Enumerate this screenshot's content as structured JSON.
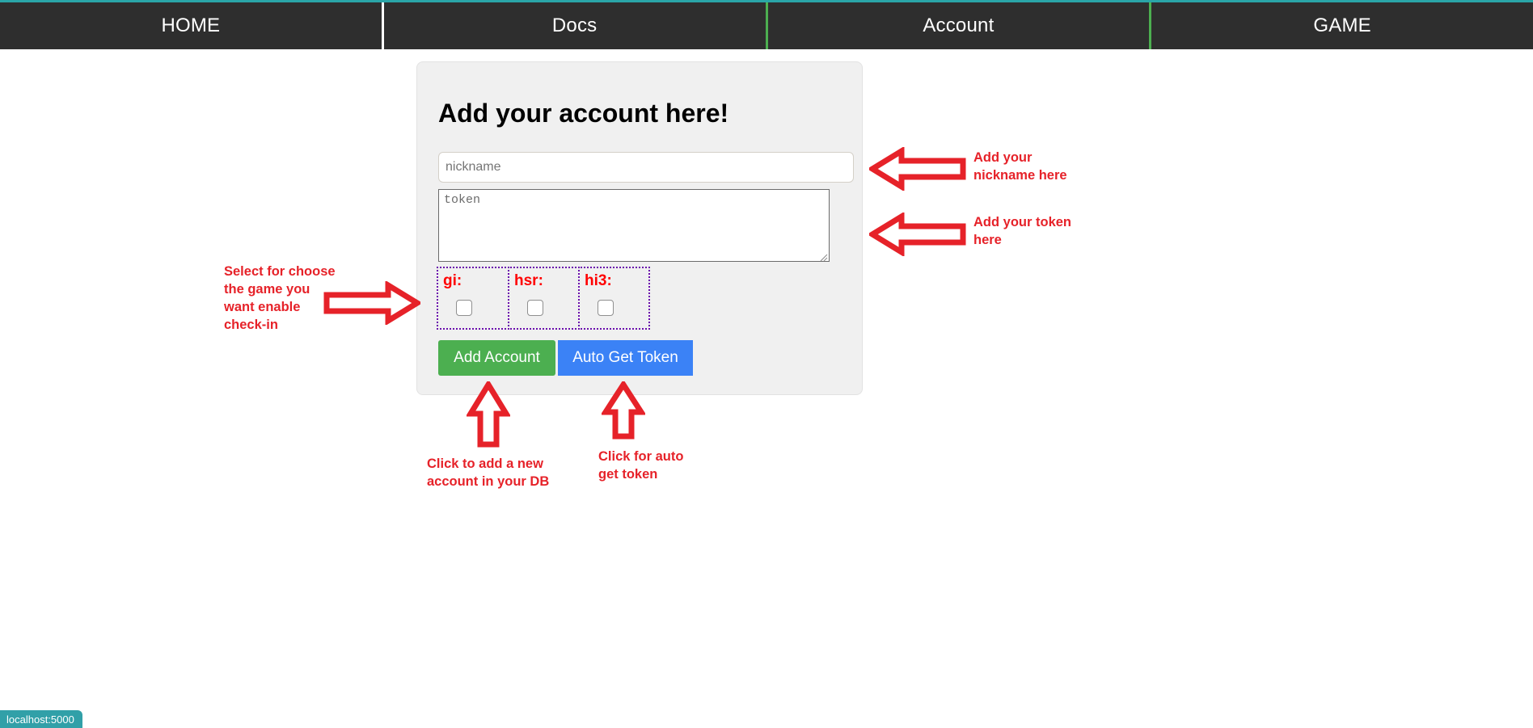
{
  "navbar": {
    "tabs": [
      {
        "label": "HOME",
        "separator": "white",
        "active": true
      },
      {
        "label": "Docs",
        "separator": "green",
        "active": false
      },
      {
        "label": "Account",
        "separator": "green",
        "active": false
      },
      {
        "label": "GAME",
        "separator": "none",
        "active": false
      }
    ],
    "background_color": "#2e2e2e",
    "top_accent_color": "#2aa5a8",
    "text_color": "#ffffff"
  },
  "card": {
    "title": "Add your account here!",
    "background_color": "#f0f0f0",
    "nickname": {
      "value": "",
      "placeholder": "nickname"
    },
    "token": {
      "value": "",
      "placeholder": "token"
    },
    "checkbox_groups": [
      {
        "label": "gi:",
        "checked": false
      },
      {
        "label": "hsr:",
        "checked": false
      },
      {
        "label": "hi3:",
        "checked": false
      }
    ],
    "buttons": {
      "add_account": {
        "label": "Add Account",
        "color": "#4caf50"
      },
      "auto_get_token": {
        "label": "Auto Get Token",
        "color": "#3b82f6"
      }
    }
  },
  "annotations": {
    "color": "#e62229",
    "nickname_hint": "Add your\nnickname here",
    "token_hint": "Add your token\nhere",
    "checkbox_hint": "Select for choose\nthe game you\nwant enable\ncheck-in",
    "add_account_hint": "Click to add a new\naccount in your DB",
    "auto_token_hint": "Click for auto\nget token"
  },
  "statusbar": {
    "text": "localhost:5000",
    "background_color": "#31a0a8"
  }
}
